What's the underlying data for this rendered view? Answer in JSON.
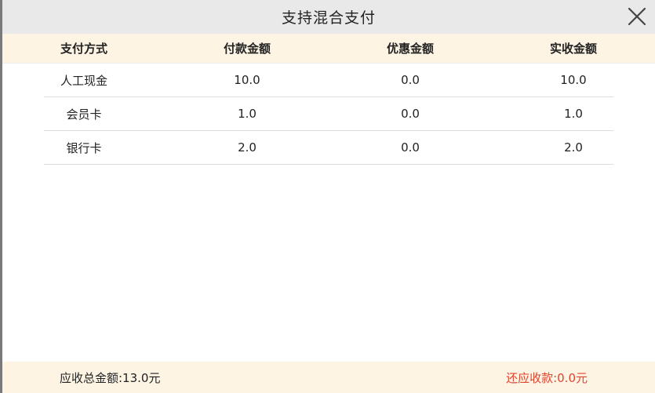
{
  "dialog": {
    "title": "支持混合支付"
  },
  "table": {
    "headers": [
      "支付方式",
      "付款金额",
      "优惠金额",
      "实收金额"
    ],
    "rows": [
      {
        "method": "人工现金",
        "paid": "10.0",
        "discount": "0.0",
        "received": "10.0"
      },
      {
        "method": "会员卡",
        "paid": "1.0",
        "discount": "0.0",
        "received": "1.0"
      },
      {
        "method": "银行卡",
        "paid": "2.0",
        "discount": "0.0",
        "received": "2.0"
      }
    ]
  },
  "footer": {
    "total_due": "应收总金额:13.0元",
    "remaining": "还应收款:0.0元"
  },
  "colors": {
    "header_bg": "#fdf4e4",
    "title_bg": "#e9e9e9",
    "remaining_text": "#e0452f"
  },
  "icons": {
    "close": "close-icon"
  }
}
